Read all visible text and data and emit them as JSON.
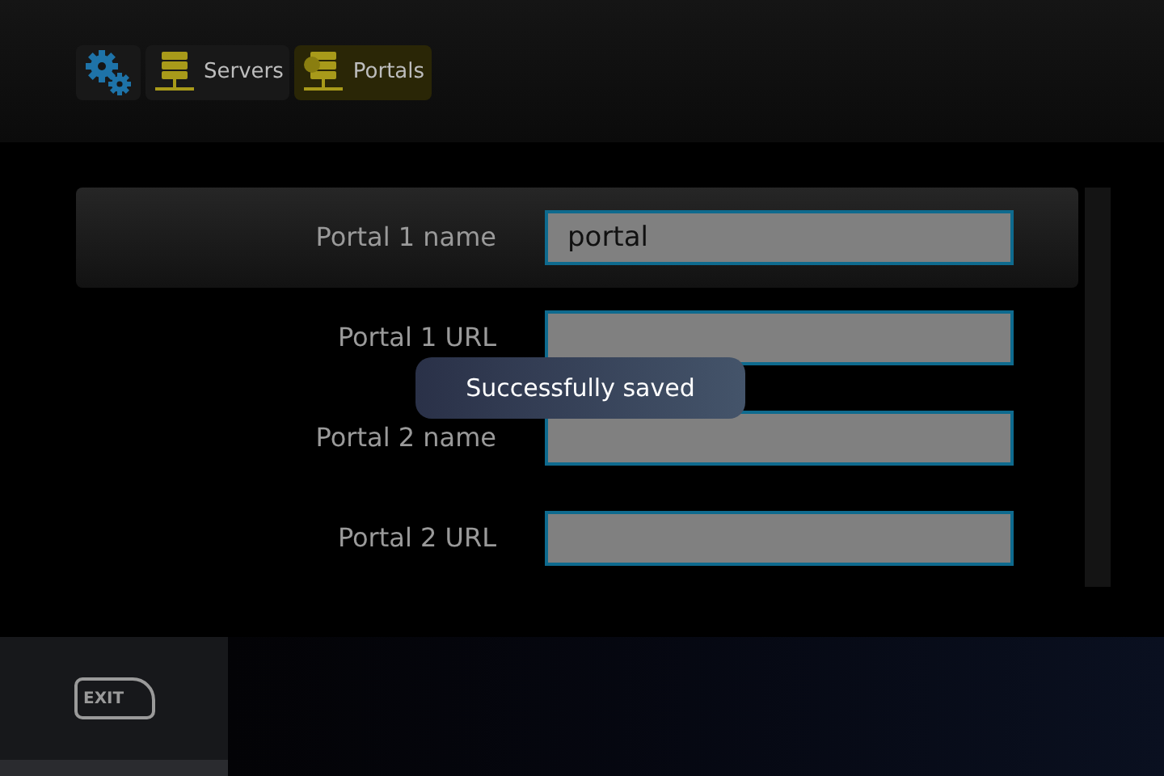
{
  "breadcrumb": [
    {
      "kind": "settings",
      "selected": false
    },
    {
      "kind": "servers",
      "label": "Servers",
      "selected": false
    },
    {
      "kind": "portals",
      "label": "Portals",
      "selected": true
    }
  ],
  "form": {
    "rows": [
      {
        "label": "Portal 1 name",
        "value": "portal",
        "focused": true
      },
      {
        "label": "Portal 1 URL",
        "value": "",
        "focused": false
      },
      {
        "label": "Portal 2 name",
        "value": "",
        "focused": false
      },
      {
        "label": "Portal 2 URL",
        "value": "",
        "focused": false
      }
    ]
  },
  "toast": "Successfully saved",
  "exit_key": "EXIT"
}
